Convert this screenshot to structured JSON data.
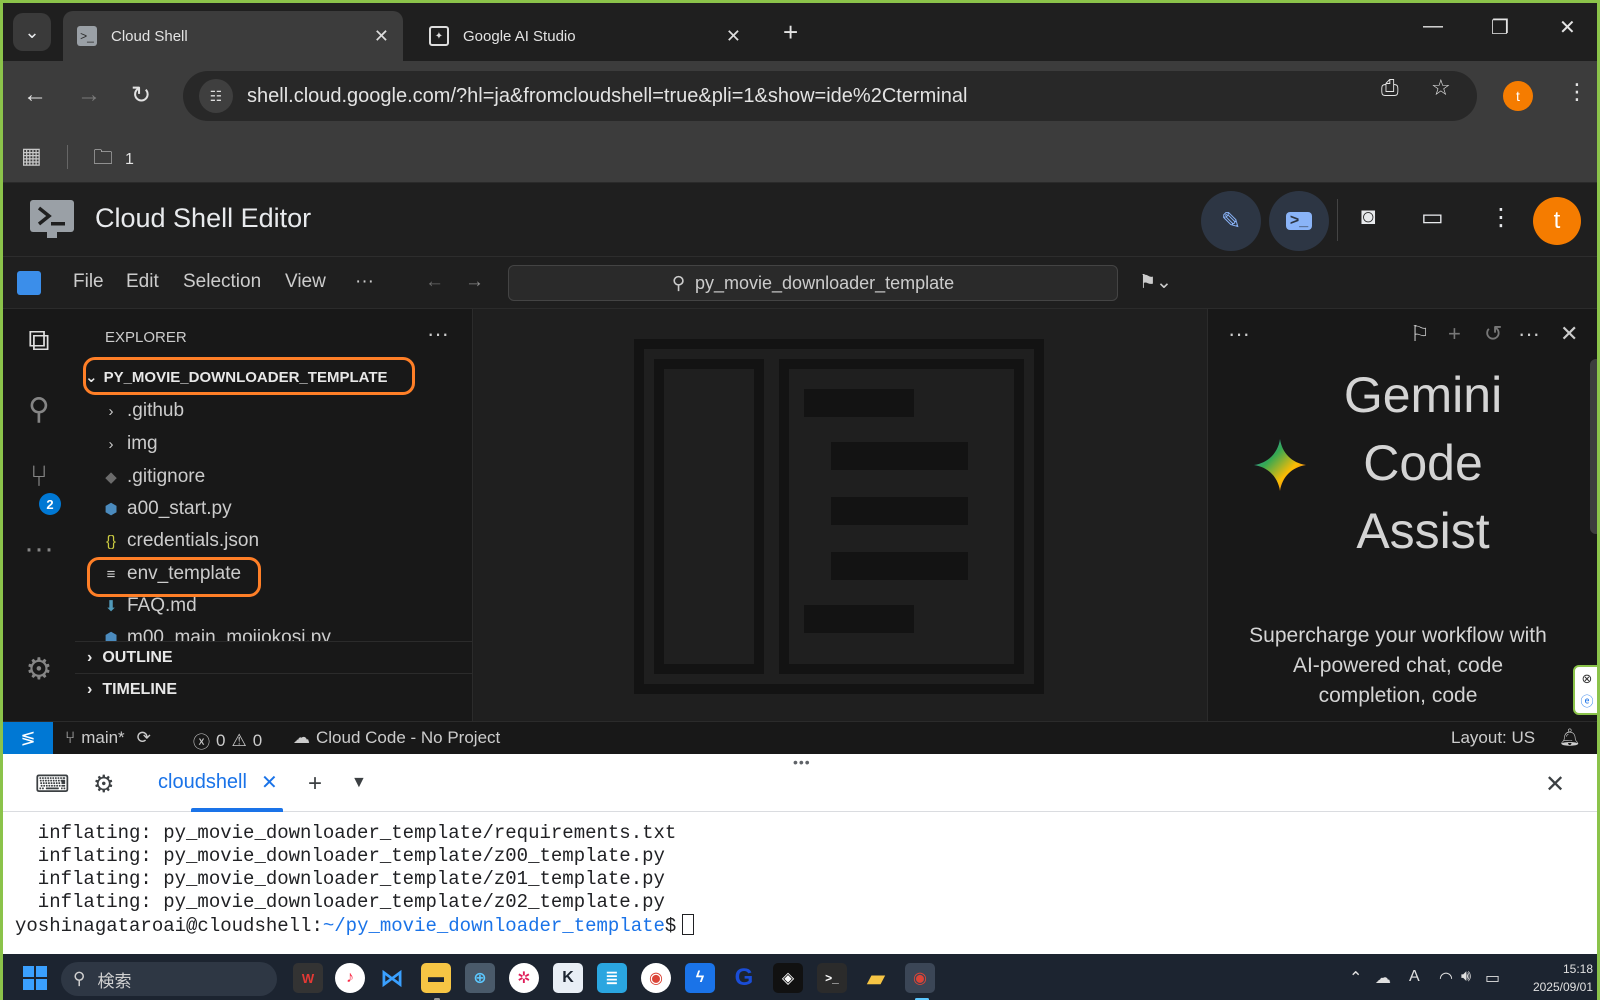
{
  "browser": {
    "tabs": [
      {
        "title": "Cloud Shell",
        "active": true
      },
      {
        "title": "Google AI Studio",
        "active": false
      }
    ],
    "url": "shell.cloud.google.com/?hl=ja&fromcloudshell=true&pli=1&show=ide%2Cterminal",
    "profile_initial": "t",
    "bookmark_folder_label": "1"
  },
  "cloudshell": {
    "title": "Cloud Shell Editor",
    "avatar_initial": "t"
  },
  "menu": {
    "items": [
      "File",
      "Edit",
      "Selection",
      "View",
      "···"
    ],
    "command_center": "py_movie_downloader_template"
  },
  "activity": {
    "scm_badge": "2"
  },
  "explorer": {
    "title": "EXPLORER",
    "root": "PY_MOVIE_DOWNLOADER_TEMPLATE",
    "items": [
      {
        "name": ".github",
        "icon": "chevron-right"
      },
      {
        "name": "img",
        "icon": "chevron-right"
      },
      {
        "name": ".gitignore",
        "icon": "git-file-icon"
      },
      {
        "name": "a00_start.py",
        "icon": "python-icon"
      },
      {
        "name": "credentials.json",
        "icon": "json-icon"
      },
      {
        "name": "env_template",
        "icon": "text-file-icon"
      },
      {
        "name": "FAQ.md",
        "icon": "markdown-icon"
      },
      {
        "name": "m00_main_mojiokosi.py",
        "icon": "python-icon"
      }
    ],
    "sections": [
      "OUTLINE",
      "TIMELINE"
    ]
  },
  "gemini": {
    "title_line1": "Gemini",
    "title_line2": "Code",
    "title_line3": "Assist",
    "description": "Supercharge your workflow with AI-powered chat, code completion, code"
  },
  "statusbar": {
    "branch": "main*",
    "errors": "0",
    "warnings": "0",
    "cloud_code": "Cloud Code - No Project",
    "layout": "Layout: US"
  },
  "terminal": {
    "tab_label": "cloudshell",
    "lines": [
      "  inflating: py_movie_downloader_template/requirements.txt",
      "  inflating: py_movie_downloader_template/z00_template.py",
      "  inflating: py_movie_downloader_template/z01_template.py",
      "  inflating: py_movie_downloader_template/z02_template.py"
    ],
    "prompt_user": "yoshinagataroai@cloudshell:",
    "prompt_path": "~/py_movie_downloader_template",
    "prompt_symbol": "$"
  },
  "taskbar": {
    "search_placeholder": "検索",
    "ime": "A",
    "time": "15:18",
    "date": "2025/09/01"
  },
  "colors": {
    "accent": "#0078d4",
    "highlight": "#ff7f27",
    "avatar": "#f57c00",
    "terminal_link": "#1a73e8"
  }
}
